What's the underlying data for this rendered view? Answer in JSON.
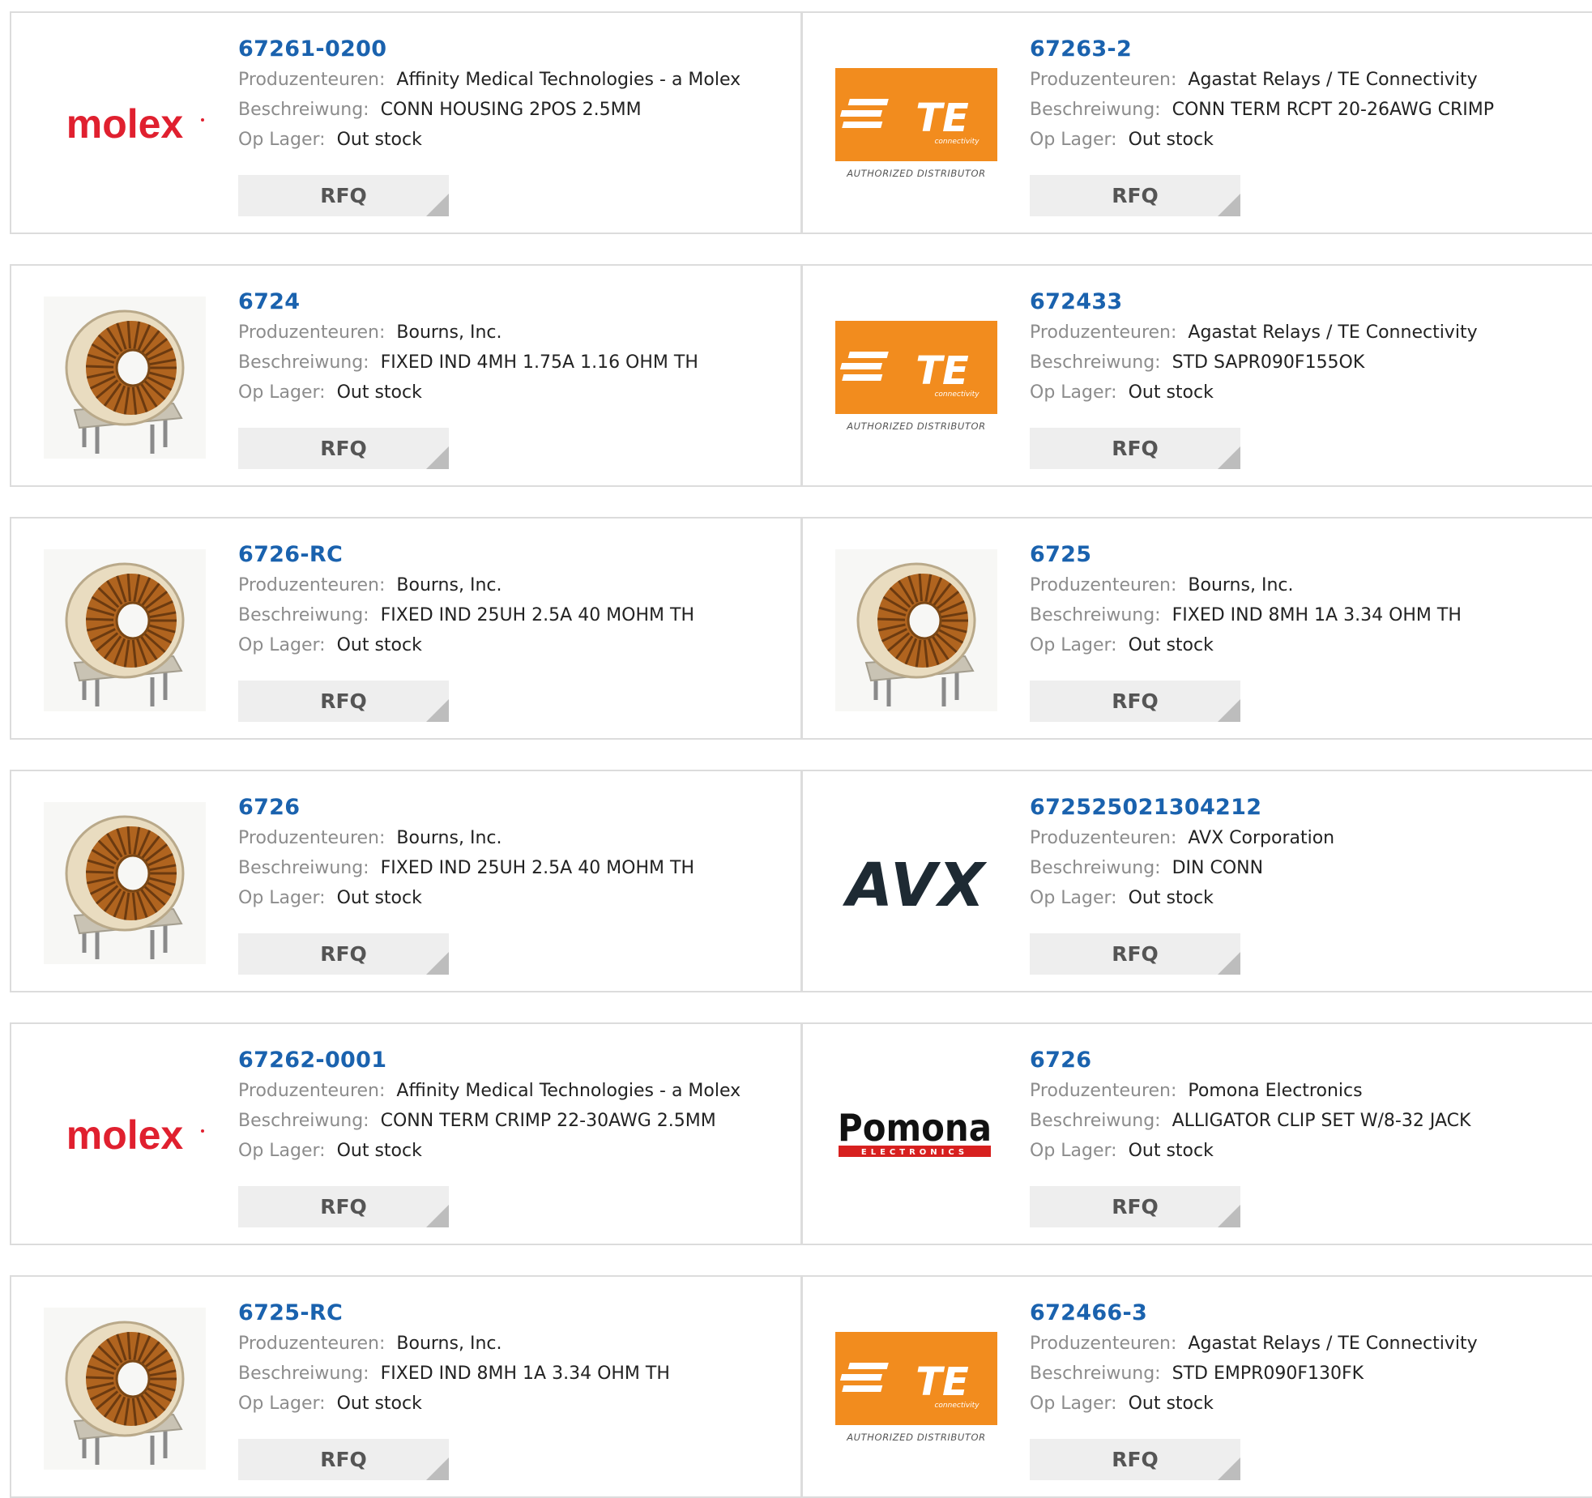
{
  "labels": {
    "manufacturer": "Produzenteuren:",
    "description": "Beschreiwung:",
    "stock": "Op Lager:",
    "rfq": "RFQ"
  },
  "logos": {
    "molex": {
      "text": "molex",
      "color": "#e0202f"
    },
    "te": {
      "text": "TE",
      "sub": "connectivity",
      "caption": "AUTHORIZED DISTRIBUTOR",
      "color": "#f28c1e"
    },
    "avx": {
      "text": "AVX",
      "color": "#1e2a33"
    },
    "pomona": {
      "text": "Pomona",
      "sub": "ELECTRONICS",
      "color": "#111111",
      "accent": "#d7201f"
    },
    "inductor": {
      "icon": "toroid-inductor-icon"
    }
  },
  "products": [
    {
      "part": "67261-0200",
      "logo": "molex",
      "manufacturer": "Affinity Medical Technologies - a Molex",
      "description": "CONN HOUSING 2POS 2.5MM",
      "stock": "Out stock"
    },
    {
      "part": "67263-2",
      "logo": "te",
      "manufacturer": "Agastat Relays / TE Connectivity",
      "description": "CONN TERM RCPT 20-26AWG CRIMP",
      "stock": "Out stock"
    },
    {
      "part": "6724",
      "logo": "inductor",
      "manufacturer": "Bourns, Inc.",
      "description": "FIXED IND 4MH 1.75A 1.16 OHM TH",
      "stock": "Out stock"
    },
    {
      "part": "672433",
      "logo": "te",
      "manufacturer": "Agastat Relays / TE Connectivity",
      "description": "STD SAPR090F155OK",
      "stock": "Out stock"
    },
    {
      "part": "6726-RC",
      "logo": "inductor",
      "manufacturer": "Bourns, Inc.",
      "description": "FIXED IND 25UH 2.5A 40 MOHM TH",
      "stock": "Out stock"
    },
    {
      "part": "6725",
      "logo": "inductor",
      "manufacturer": "Bourns, Inc.",
      "description": "FIXED IND 8MH 1A 3.34 OHM TH",
      "stock": "Out stock"
    },
    {
      "part": "6726",
      "logo": "inductor",
      "manufacturer": "Bourns, Inc.",
      "description": "FIXED IND 25UH 2.5A 40 MOHM TH",
      "stock": "Out stock"
    },
    {
      "part": "672525021304212",
      "logo": "avx",
      "manufacturer": "AVX Corporation",
      "description": "DIN CONN",
      "stock": "Out stock"
    },
    {
      "part": "67262-0001",
      "logo": "molex",
      "manufacturer": "Affinity Medical Technologies - a Molex",
      "description": "CONN TERM CRIMP 22-30AWG 2.5MM",
      "stock": "Out stock"
    },
    {
      "part": "6726",
      "logo": "pomona",
      "manufacturer": "Pomona Electronics",
      "description": "ALLIGATOR CLIP SET W/8-32 JACK",
      "stock": "Out stock"
    },
    {
      "part": "6725-RC",
      "logo": "inductor",
      "manufacturer": "Bourns, Inc.",
      "description": "FIXED IND 8MH 1A 3.34 OHM TH",
      "stock": "Out stock"
    },
    {
      "part": "672466-3",
      "logo": "te",
      "manufacturer": "Agastat Relays / TE Connectivity",
      "description": "STD EMPR090F130FK",
      "stock": "Out stock"
    }
  ]
}
